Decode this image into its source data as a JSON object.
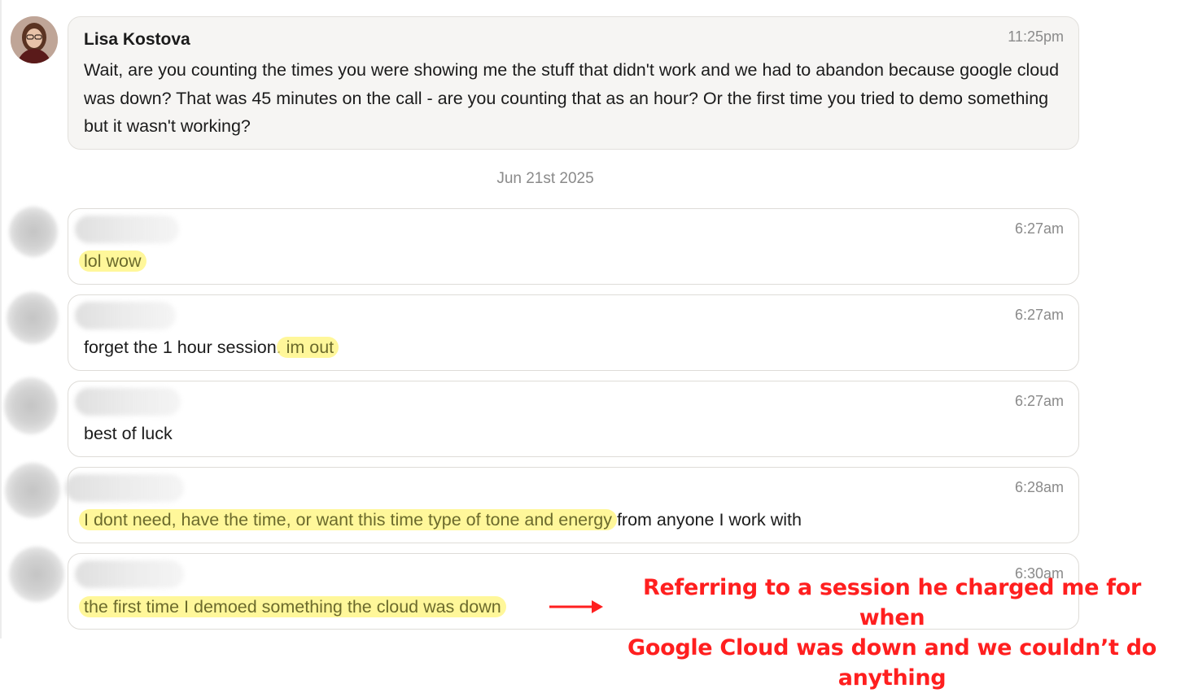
{
  "messages": [
    {
      "sender": "Lisa Kostova",
      "time": "11:25pm",
      "text": "Wait, are you counting the times you were showing me the stuff that didn't work and we had to abandon because google cloud was down? That was 45 minutes on the call - are you counting that as an hour? Or the first time you tried to demo something but it wasn't working?"
    },
    {
      "time": "6:27am",
      "text_highlight": "lol wow"
    },
    {
      "time": "6:27am",
      "text_plain": "forget the 1 hour session.",
      "text_highlight": " im out"
    },
    {
      "time": "6:27am",
      "text_plain": "best of luck"
    },
    {
      "time": "6:28am",
      "text_highlight": "I dont need, have the time, or want this time type of tone and energy",
      "text_plain": " from anyone I work with"
    },
    {
      "time": "6:30am",
      "text_highlight": "the first time I demoed something the cloud was down"
    }
  ],
  "date_divider": "Jun 21st 2025",
  "annotation": {
    "line1": "Referring to a session he charged me for when",
    "line2": "Google Cloud was down and we couldn’t do anything",
    "color": "#ff1f1f"
  },
  "colors": {
    "highlight": "#fff478",
    "bubble_border": "#dedcd8",
    "own_bubble_bg": "#f6f5f3",
    "timestamp": "#8a8a8a"
  }
}
